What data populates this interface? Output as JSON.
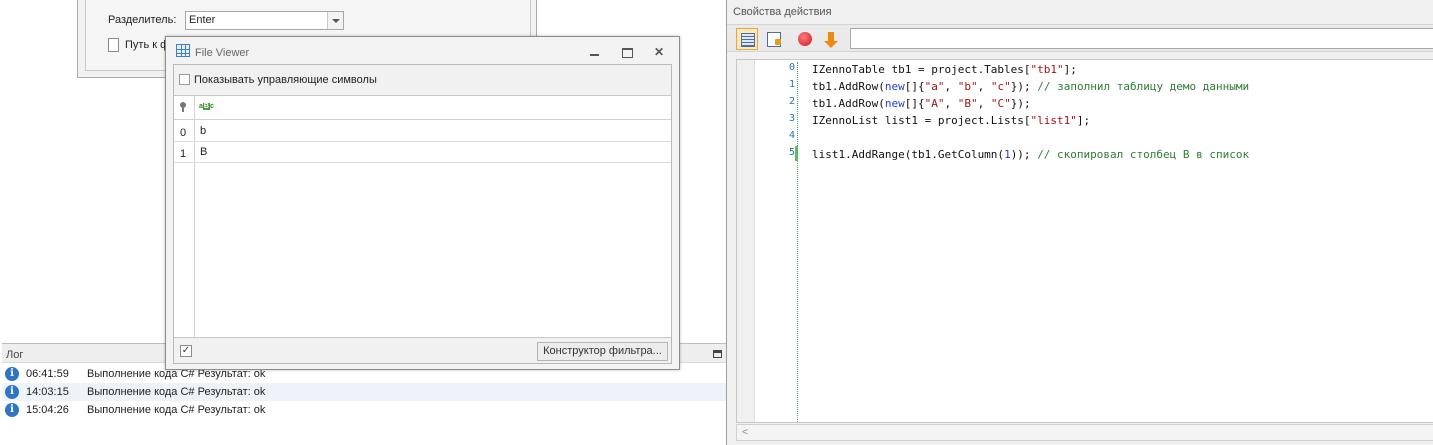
{
  "back_dialog": {
    "separator_label": "Разделитель:",
    "separator_value": "Enter",
    "file_path_label": "Путь к фа"
  },
  "log": {
    "title": "Лог",
    "rows": [
      {
        "time": "06:41:59",
        "message": "Выполнение кода C#  Результат: ok"
      },
      {
        "time": "14:03:15",
        "message": "Выполнение кода C#  Результат: ok"
      },
      {
        "time": "15:04:26",
        "message": "Выполнение кода C#  Результат: ok"
      }
    ]
  },
  "file_viewer": {
    "title": "File Viewer",
    "close_glyph": "✕",
    "show_control_chars_label": "Показывать управляющие символы",
    "abc_icon": [
      "a",
      "B",
      "c"
    ],
    "rows": [
      {
        "index": "0",
        "value": "b"
      },
      {
        "index": "1",
        "value": "B"
      }
    ],
    "footer_check_glyph": "✓",
    "filter_button_label": "Конструктор фильтра..."
  },
  "action_properties": {
    "title": "Свойства действия",
    "input_value": "",
    "code_lines": [
      {
        "num": "0",
        "tokens": [
          {
            "t": "IZennoTable tb1 = project.Tables[",
            "c": ""
          },
          {
            "t": "\"tb1\"",
            "c": "str"
          },
          {
            "t": "];",
            "c": ""
          }
        ]
      },
      {
        "num": "1",
        "tokens": [
          {
            "t": "tb1.AddRow(",
            "c": ""
          },
          {
            "t": "new",
            "c": "kw"
          },
          {
            "t": "[]{",
            "c": ""
          },
          {
            "t": "\"a\"",
            "c": "str"
          },
          {
            "t": ", ",
            "c": ""
          },
          {
            "t": "\"b\"",
            "c": "str"
          },
          {
            "t": ", ",
            "c": ""
          },
          {
            "t": "\"c\"",
            "c": "str"
          },
          {
            "t": "}); ",
            "c": ""
          },
          {
            "t": "// заполнил таблицу демо данными",
            "c": "cm"
          }
        ]
      },
      {
        "num": "2",
        "tokens": [
          {
            "t": "tb1.AddRow(",
            "c": ""
          },
          {
            "t": "new",
            "c": "kw"
          },
          {
            "t": "[]{",
            "c": ""
          },
          {
            "t": "\"A\"",
            "c": "str"
          },
          {
            "t": ", ",
            "c": ""
          },
          {
            "t": "\"B\"",
            "c": "str"
          },
          {
            "t": ", ",
            "c": ""
          },
          {
            "t": "\"C\"",
            "c": "str"
          },
          {
            "t": "});",
            "c": ""
          }
        ]
      },
      {
        "num": "3",
        "tokens": [
          {
            "t": "IZennoList list1 = project.Lists[",
            "c": ""
          },
          {
            "t": "\"list1\"",
            "c": "str"
          },
          {
            "t": "];",
            "c": ""
          }
        ]
      },
      {
        "num": "4",
        "tokens": []
      },
      {
        "num": "5",
        "tokens": [
          {
            "t": "list1.AddRange(tb1.GetColumn(",
            "c": ""
          },
          {
            "t": "1",
            "c": "num"
          },
          {
            "t": ")); ",
            "c": ""
          },
          {
            "t": "// скопировал столбец B в список",
            "c": "cm"
          }
        ]
      }
    ],
    "scroll_left_glyph": "<"
  }
}
